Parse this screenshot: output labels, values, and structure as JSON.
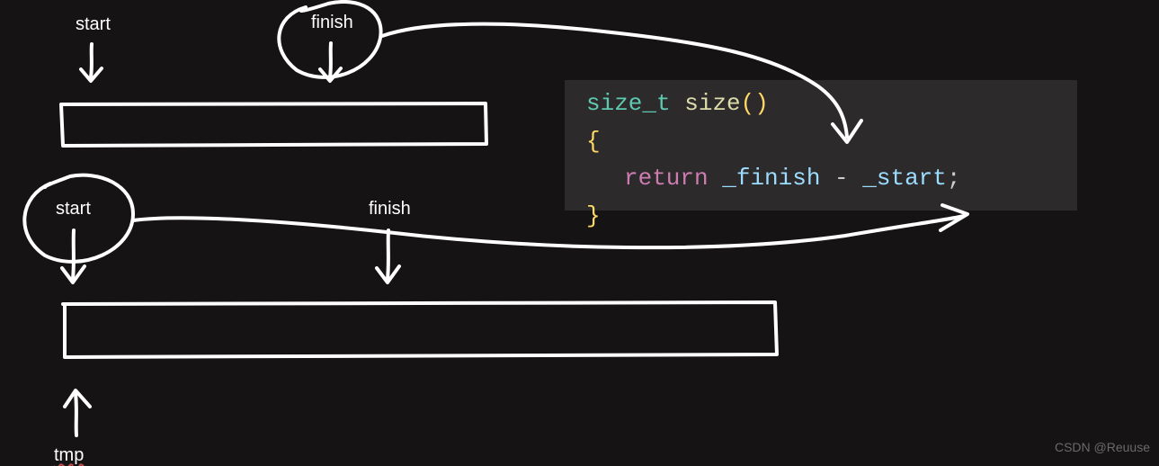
{
  "diagram": {
    "top": {
      "start_label": "start",
      "finish_label": "finish"
    },
    "bottom": {
      "start_label": "start",
      "finish_label": "finish",
      "tmp_label": "tmp"
    }
  },
  "code": {
    "type_kw": "size_t",
    "fn_name": "size",
    "parens": "()",
    "brace_open": "{",
    "return_kw": "return",
    "operand1": "_finish",
    "minus": " - ",
    "operand2": "_start",
    "semi": ";",
    "brace_close": "}"
  },
  "watermark": "CSDN @Reuuse"
}
